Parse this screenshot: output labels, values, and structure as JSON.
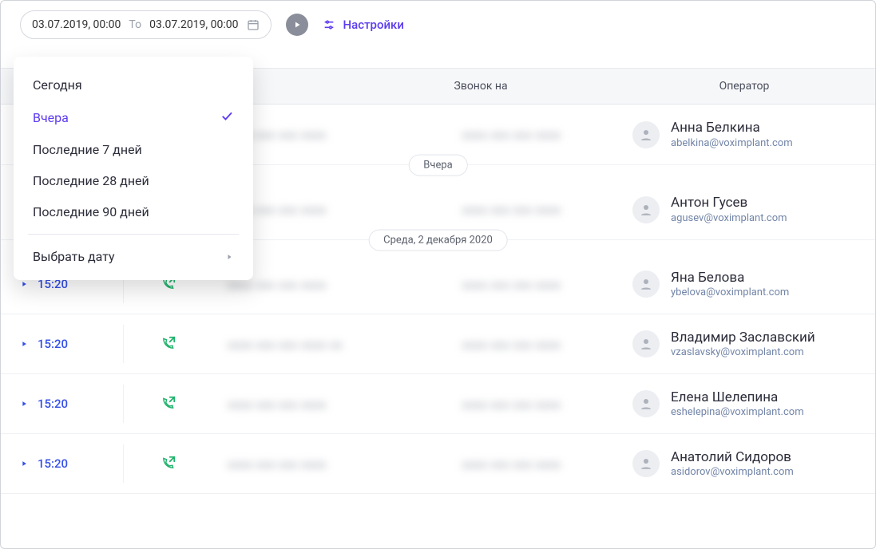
{
  "toolbar": {
    "date_from": "03.07.2019, 00:00",
    "date_sep": "To",
    "date_to": "03.07.2019, 00:00",
    "settings_label": "Настройки"
  },
  "dropdown": {
    "items": [
      {
        "label": "Сегодня",
        "selected": false
      },
      {
        "label": "Вчера",
        "selected": true
      },
      {
        "label": "Последние 7 дней",
        "selected": false
      },
      {
        "label": "Последние 28 дней",
        "selected": false
      },
      {
        "label": "Последние 90 дней",
        "selected": false
      }
    ],
    "custom_label": "Выбрать дату"
  },
  "table": {
    "headers": {
      "call_to": "Звонок на",
      "operator": "Оператор"
    },
    "groups": [
      {
        "label": null,
        "rows": [
          {
            "time": null,
            "direction": null,
            "num1": "xxxx  xxx xxx xxxx",
            "num2": "xxxx  xxx xxx xxxx",
            "op_name": "Анна Белкина",
            "op_email": "abelkina@voximplant.com"
          }
        ]
      },
      {
        "label": "Вчера",
        "rows": [
          {
            "time": null,
            "direction": null,
            "num1": "xxxx  xxx xxx xxxx",
            "num2": "xxxx  xxx xxx xxxx",
            "op_name": "Антон Гусев",
            "op_email": "agusev@voximplant.com"
          }
        ]
      },
      {
        "label": "Среда, 2 декабря 2020",
        "rows": [
          {
            "time": "15:20",
            "direction": "out",
            "num1": "xxxx  xxx xxx xxxx",
            "num2": "xxxx  xxx xxx xxxx",
            "op_name": "Яна Белова",
            "op_email": "ybelova@voximplant.com"
          },
          {
            "time": "15:20",
            "direction": "out",
            "num1": "xxxx  xxx xxx xxxx xx",
            "num2": "xxxx  xxx xxx xxxx",
            "op_name": "Владимир Заславский",
            "op_email": "vzaslavsky@voximplant.com"
          },
          {
            "time": "15:20",
            "direction": "out",
            "num1": "xxxx  xxx xxx xxxx",
            "num2": "xxxx  xxx xxx xxxx",
            "op_name": "Елена Шелепина",
            "op_email": "eshelepina@voximplant.com"
          },
          {
            "time": "15:20",
            "direction": "out",
            "num1": "xxxx  xxx xxx xxxx",
            "num2": "xxxx  xxx xxx xxxx",
            "op_name": "Анатолий Сидоров",
            "op_email": "asidorov@voximplant.com"
          }
        ]
      }
    ]
  }
}
